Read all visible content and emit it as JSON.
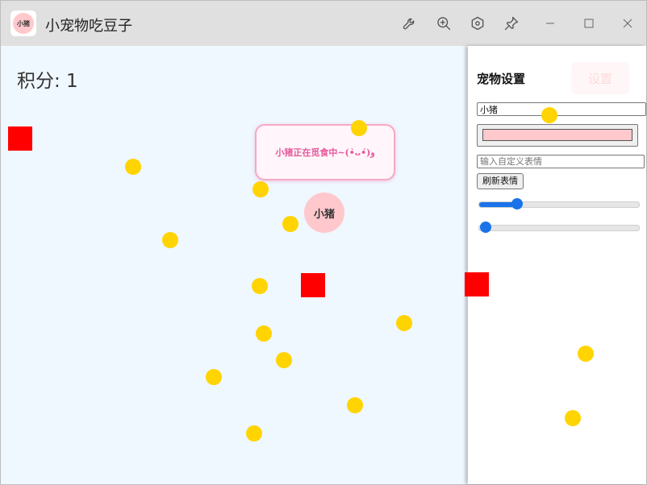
{
  "window": {
    "title": "小宠物吃豆子",
    "icon_label": "小猪",
    "controls": [
      "wrench-icon",
      "zoom-in-icon",
      "hexagon-settings-icon",
      "pin-icon",
      "minimize-icon",
      "maximize-icon",
      "close-icon"
    ]
  },
  "game": {
    "score_label": "积分: 1",
    "pet_name": "小猪",
    "pet_color": "#ffc8cc",
    "speech": "小猪正在觅食中~(•̀ᴗ•́)و",
    "food_color": "#ffd400",
    "obstacle_color": "#ff0000"
  },
  "panel": {
    "title": "宠物设置",
    "settings_button": "设置",
    "name_value": "小猪",
    "color_value": "#ffc8cc",
    "emoji_placeholder": "输入自定义表情",
    "refresh_button": "刷新表情",
    "slider1_value": 0.24,
    "slider2_value": 0.0
  }
}
